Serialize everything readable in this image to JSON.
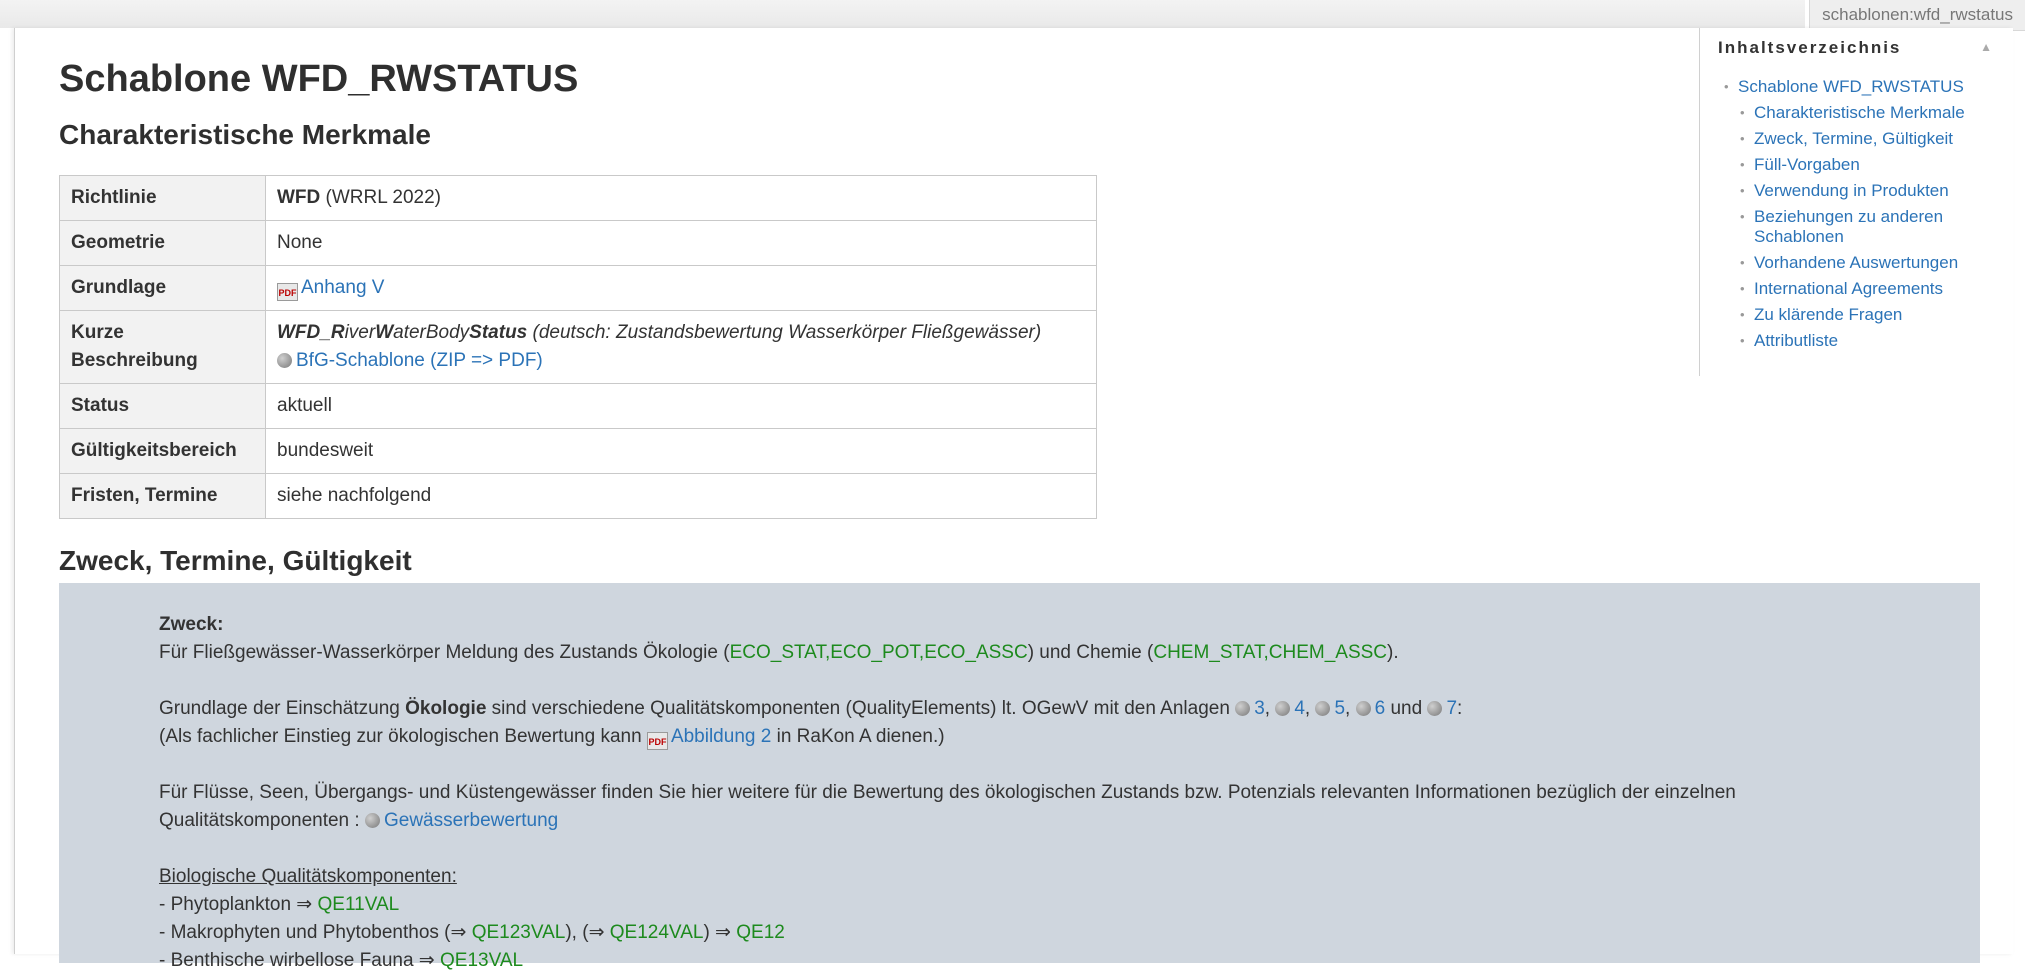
{
  "page_id": "schablonen:wfd_rwstatus",
  "title": "Schablone WFD_RWSTATUS",
  "section1": "Charakteristische Merkmale",
  "table": {
    "richtlinie_label": "Richtlinie",
    "richtlinie_bold": "WFD",
    "richtlinie_rest": " (WRRL 2022)",
    "geometrie_label": "Geometrie",
    "geometrie_value": "None",
    "grundlage_label": "Grundlage",
    "grundlage_link": "Anhang V",
    "kurz_label": "Kurze Beschreibung",
    "kurz_p1": "WFD_",
    "kurz_p2": "R",
    "kurz_p3": "iver",
    "kurz_p4": "W",
    "kurz_p5": "aterBody",
    "kurz_p6": "Status",
    "kurz_p7": " (deutsch: Zustandsbewertung Wasserkörper Fließgewässer)",
    "kurz_link": "BfG-Schablone (ZIP => PDF)",
    "status_label": "Status",
    "status_value": "aktuell",
    "gueltig_label": "Gültigkeitsbereich",
    "gueltig_value": "bundesweit",
    "fristen_label": "Fristen, Termine",
    "fristen_value": "siehe nachfolgend"
  },
  "section2": "Zweck, Termine, Gültigkeit",
  "box": {
    "zweck_label": "Zweck:",
    "l1_a": "Für Fließgewässer-Wasserkörper Meldung des Zustands Ökologie (",
    "l1_b": "ECO_STAT,ECO_POT,ECO_ASSC",
    "l1_c": ") und Chemie (",
    "l1_d": "CHEM_STAT,CHEM_ASSC",
    "l1_e": ").",
    "l2_a": "Grundlage der Einschätzung ",
    "l2_b": "Ökologie",
    "l2_c": " sind verschiedene Qualitätskomponenten (QualityElements) lt. OGewV mit den Anlagen ",
    "anl3": "3",
    "anl4": "4",
    "anl5": "5",
    "anl6": "6",
    "und": " und ",
    "anl7": "7",
    "colon": ":",
    "l3_a": "(Als fachlicher Einstieg zur ökologischen Bewertung kann ",
    "l3_link": "Abbildung 2",
    "l3_b": " in RaKon A dienen.)",
    "l4": "Für Flüsse, Seen, Übergangs- und Küstengewässer finden Sie hier weitere für die Bewertung des ökologischen Zustands bzw. Potenzials relevanten Informationen bezüglich der einzelnen",
    "l5_a": "Qualitätskomponenten : ",
    "l5_link": "Gewässerbewertung",
    "bio_label": "Biologische Qualitätskomponenten:",
    "b1_a": "- Phytoplankton ⇒ ",
    "b1_b": "QE11VAL",
    "b2_a": "- Makrophyten und Phytobenthos (⇒ ",
    "b2_b": "QE123VAL",
    "b2_c": "), (⇒ ",
    "b2_d": "QE124VAL",
    "b2_e": ") ⇒ ",
    "b2_f": "QE12",
    "b3_a": "- Benthische wirbellose Fauna ⇒ ",
    "b3_b": "QE13VAL"
  },
  "toc": {
    "heading": "Inhaltsverzeichnis",
    "toggle": "▲",
    "top": "Schablone WFD_RWSTATUS",
    "items": [
      "Charakteristische Merkmale",
      "Zweck, Termine, Gültigkeit",
      "Füll-Vorgaben",
      "Verwendung in Produkten",
      "Beziehungen zu anderen Schablonen",
      "Vorhandene Auswertungen",
      "International Agreements",
      "Zu klärende Fragen",
      "Attributliste"
    ]
  }
}
